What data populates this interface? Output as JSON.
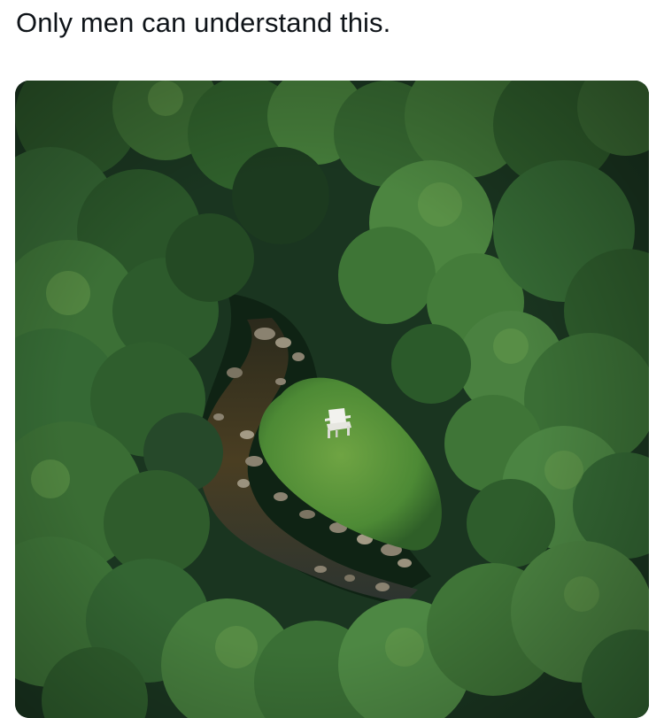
{
  "post": {
    "text": "Only men can understand this."
  },
  "media": {
    "alt": "",
    "colors": {
      "canopy_dark": "#12271a",
      "canopy_mid": "#2e5a2e",
      "canopy_light": "#4f8a3f",
      "clearing_grass": "#5f9a3c",
      "stream_water": "#3a3320",
      "stream_rock": "#8a8270",
      "chair": "#f2f2ee"
    },
    "subjects": [
      "forest-canopy-left",
      "forest-canopy-right",
      "forest-canopy-top",
      "forest-canopy-bottom",
      "stream",
      "grass-clearing",
      "white-plastic-chair"
    ]
  }
}
